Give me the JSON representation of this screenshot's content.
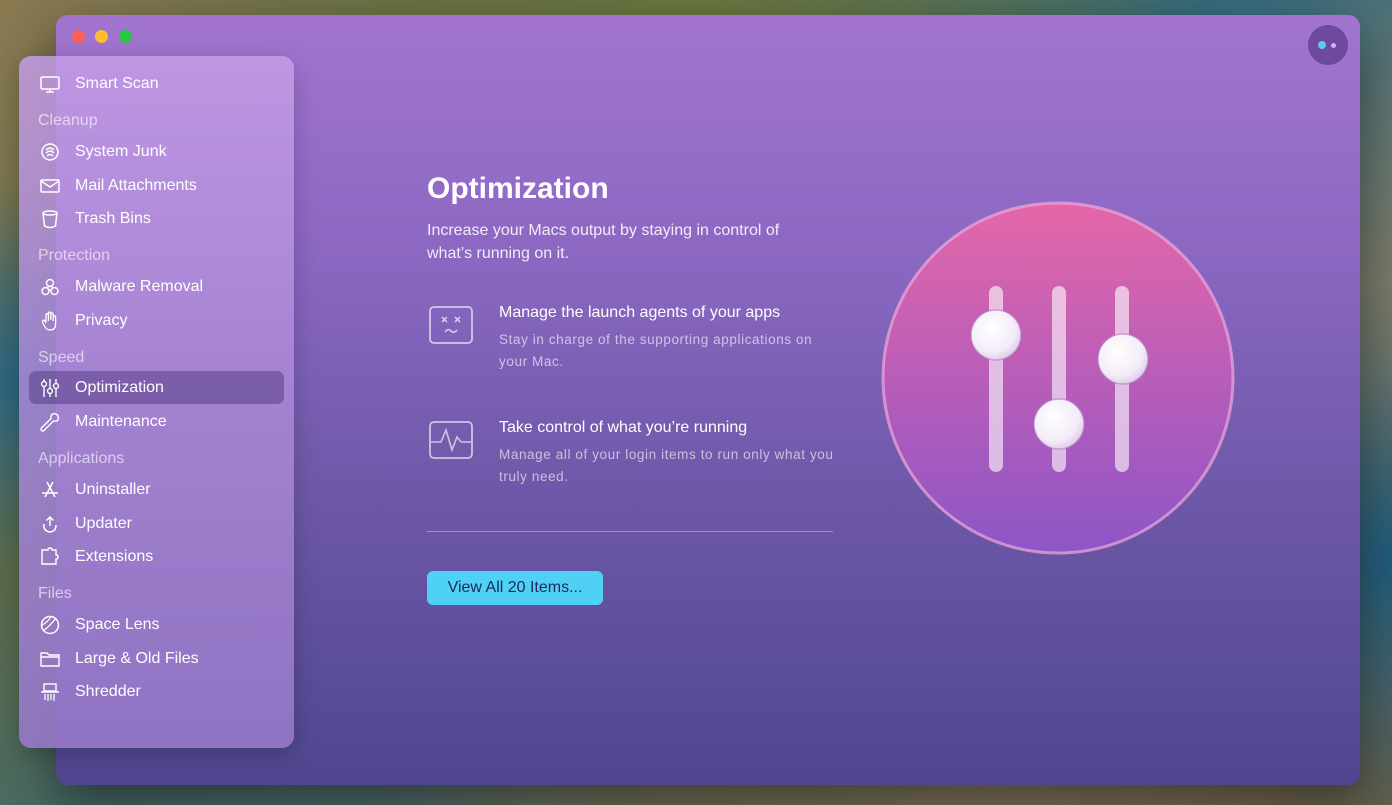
{
  "sidebar": {
    "smart_scan": "Smart Scan",
    "sections": {
      "cleanup": "Cleanup",
      "protection": "Protection",
      "speed": "Speed",
      "applications": "Applications",
      "files": "Files"
    },
    "items": {
      "system_junk": "System Junk",
      "mail_attachments": "Mail Attachments",
      "trash_bins": "Trash Bins",
      "malware_removal": "Malware Removal",
      "privacy": "Privacy",
      "optimization": "Optimization",
      "maintenance": "Maintenance",
      "uninstaller": "Uninstaller",
      "updater": "Updater",
      "extensions": "Extensions",
      "space_lens": "Space Lens",
      "large_old_files": "Large & Old Files",
      "shredder": "Shredder"
    },
    "selected": "optimization"
  },
  "main": {
    "title": "Optimization",
    "description": "Increase your Macs output by staying in control of what’s running on it.",
    "features": [
      {
        "title": "Manage the launch agents of your apps",
        "description": "Stay in charge of the supporting applications on your Mac.",
        "icon": "launch-agents-icon"
      },
      {
        "title": "Take control of what you’re running",
        "description": "Manage all of your login items to run only what you truly need.",
        "icon": "activity-monitor-icon"
      }
    ],
    "view_all_button": "View All 20 Items..."
  },
  "colors": {
    "accent_button": "#4fd1f5",
    "window_top": "#a274cf",
    "window_bottom": "#4f468f",
    "hero_top": "#e467a8",
    "hero_bottom": "#8d56c6"
  }
}
